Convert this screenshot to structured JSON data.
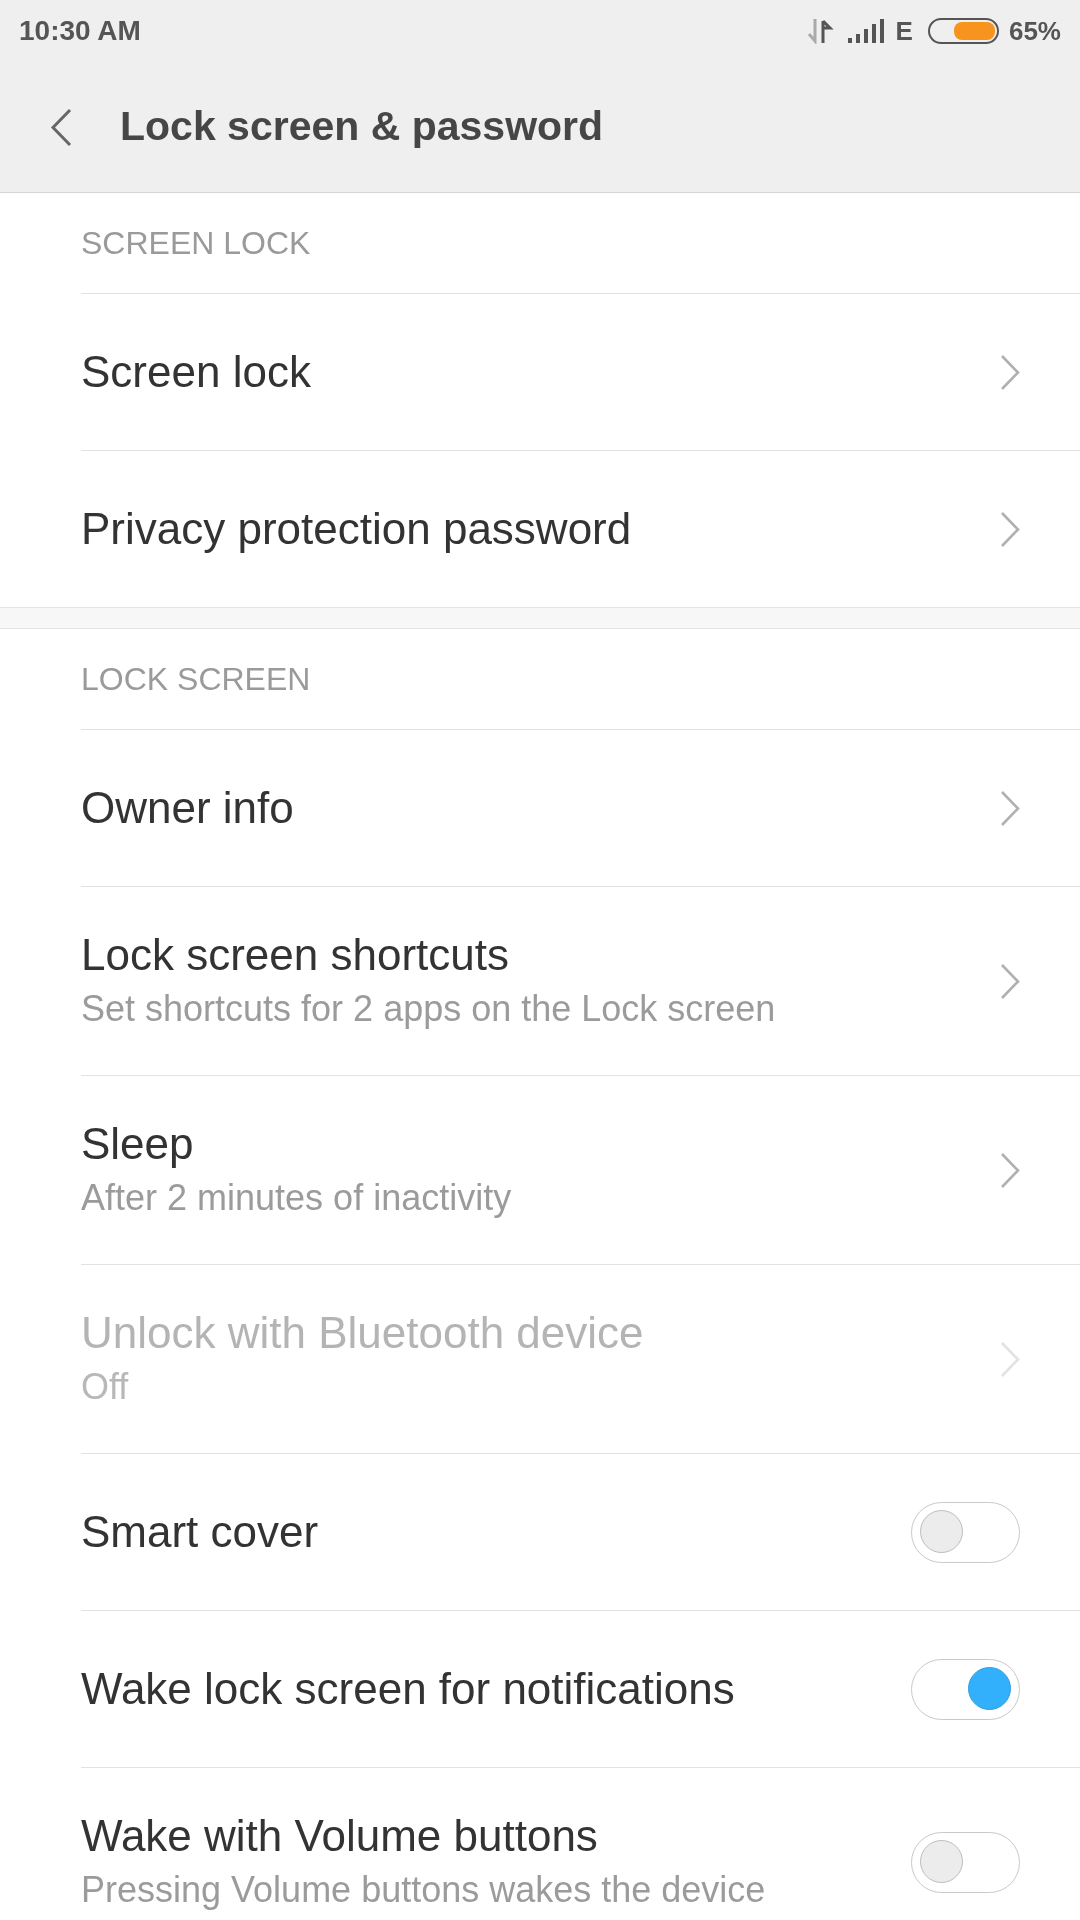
{
  "status_bar": {
    "time": "10:30 AM",
    "network": "E",
    "battery": "65%"
  },
  "toolbar": {
    "title": "Lock screen & password"
  },
  "sections": [
    {
      "header": "SCREEN LOCK",
      "items": [
        {
          "kind": "link",
          "title": "Screen lock",
          "disabled": false
        },
        {
          "kind": "link",
          "title": "Privacy protection password",
          "disabled": false
        }
      ]
    },
    {
      "header": "LOCK SCREEN",
      "items": [
        {
          "kind": "link",
          "title": "Owner info",
          "disabled": false
        },
        {
          "kind": "link",
          "title": "Lock screen shortcuts",
          "subtitle": "Set shortcuts for 2 apps on the Lock screen",
          "disabled": false
        },
        {
          "kind": "link",
          "title": "Sleep",
          "subtitle": "After 2 minutes of inactivity",
          "disabled": false
        },
        {
          "kind": "link",
          "title": "Unlock with Bluetooth device",
          "subtitle": "Off",
          "disabled": true
        },
        {
          "kind": "toggle",
          "title": "Smart cover",
          "on": false,
          "disabled": false
        },
        {
          "kind": "toggle",
          "title": "Wake lock screen for notifications",
          "on": true,
          "disabled": false
        },
        {
          "kind": "toggle",
          "title": "Wake with Volume buttons",
          "subtitle": "Pressing Volume buttons wakes the device",
          "on": false,
          "disabled": false
        }
      ]
    }
  ]
}
